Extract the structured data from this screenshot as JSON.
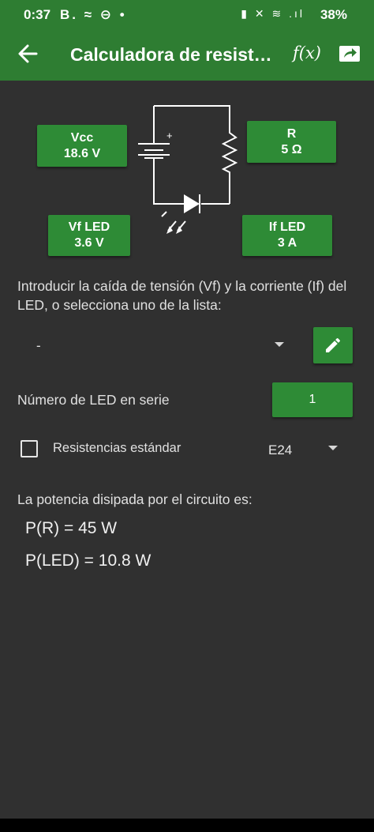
{
  "status_bar": {
    "time": "0:37",
    "left_icons": "B. ≈ ⊖ •",
    "right_icons": "▮ ✕ ≋ .ıl",
    "battery": "38%"
  },
  "app_bar": {
    "title": "Calculadora de resist…",
    "fx_label": "f(x)",
    "back_icon": "arrow-back-icon",
    "share_icon": "share-icon"
  },
  "circuit": {
    "vcc": {
      "label": "Vcc",
      "value": "18.6 V"
    },
    "r": {
      "label": "R",
      "value": "5 Ω"
    },
    "vf_led": {
      "label": "Vf LED",
      "value": "3.6 V"
    },
    "if_led": {
      "label": "If LED",
      "value": "3 A"
    },
    "battery_plus": "+"
  },
  "intro_text": "Introducir la caída de tensión (Vf) y la corriente (If) del LED, o selecciona uno de la lista:",
  "led_select": {
    "value": "-"
  },
  "led_count": {
    "label": "Número de LED en serie",
    "value": "1"
  },
  "standard": {
    "label": "Resistencias estándar",
    "checked": false,
    "series": "E24"
  },
  "power": {
    "label": "La potencia disipada por el circuito es:",
    "pr": "P(R) = 45 W",
    "pled": "P(LED) = 10.8 W"
  },
  "colors": {
    "accent": "#2e7d32",
    "button": "#2e8b36",
    "background": "#303030"
  }
}
